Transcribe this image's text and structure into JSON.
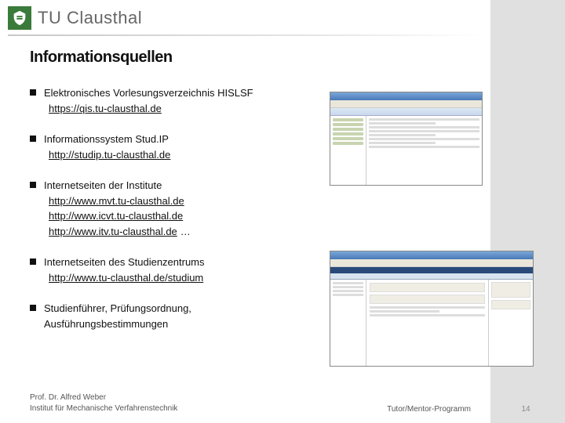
{
  "header": {
    "university": "TU Clausthal",
    "logo_icon": "coat-of-arms-icon"
  },
  "title": "Informationsquellen",
  "bullets": [
    {
      "label": "Elektronisches Vorlesungsverzeichnis HISLSF",
      "links": [
        "https://qis.tu-clausthal.de"
      ]
    },
    {
      "label": "Informationssystem Stud.IP",
      "links": [
        "http://studip.tu-clausthal.de"
      ]
    },
    {
      "label": "Internetseiten der Institute",
      "links": [
        "http://www.mvt.tu-clausthal.de",
        "http://www.icvt.tu-clausthal.de",
        "http://www.itv.tu-clausthal.de"
      ],
      "trailing": "…"
    },
    {
      "label": "Internetseiten des Studienzentrums",
      "links": [
        "http://www.tu-clausthal.de/studium"
      ]
    },
    {
      "label": "Studienführer, Prüfungsordnung, Ausführungsbestimmungen",
      "links": []
    }
  ],
  "footer": {
    "author": "Prof. Dr. Alfred Weber",
    "institute": "Institut für Mechanische Verfahrenstechnik",
    "program": "Tutor/Mentor-Programm",
    "page": "14"
  }
}
